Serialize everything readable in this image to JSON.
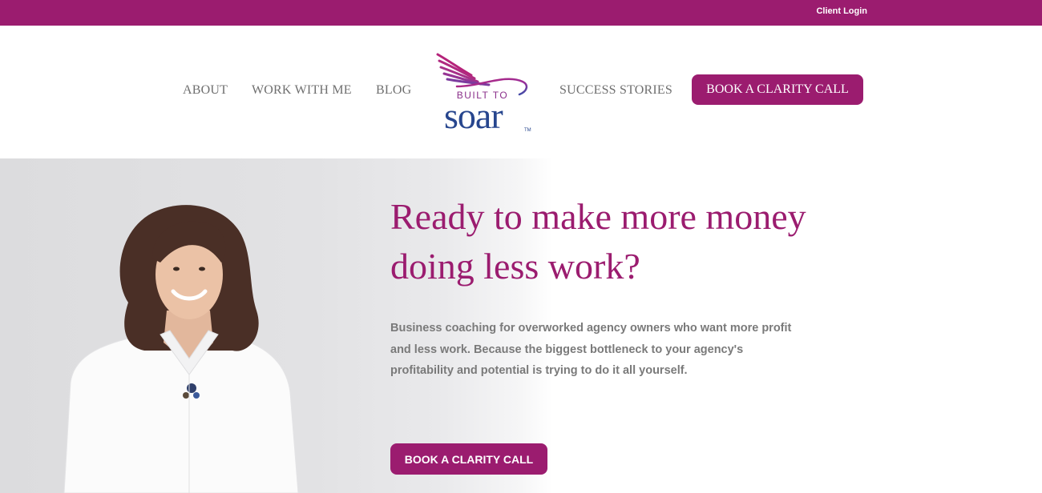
{
  "topbar": {
    "client_login": "Client Login"
  },
  "nav": {
    "items": [
      {
        "label": "ABOUT"
      },
      {
        "label": "WORK WITH ME"
      },
      {
        "label": "BLOG"
      },
      {
        "label": "SUCCESS STORIES"
      }
    ],
    "cta": "BOOK A CLARITY CALL"
  },
  "logo": {
    "line1": "BUILT TO",
    "line2": "soar",
    "tm": "TM"
  },
  "hero": {
    "headline": "Ready to make more money doing less work?",
    "subtext": "Business coaching for overworked agency owners who want more profit and less work. Because the biggest bottleneck to your agency's profitability and potential is trying to do it all yourself.",
    "cta": "BOOK A CLARITY CALL"
  },
  "colors": {
    "brand": "#9b1c6f",
    "logo_blue": "#27468e",
    "text_gray": "#7a7a7a"
  }
}
